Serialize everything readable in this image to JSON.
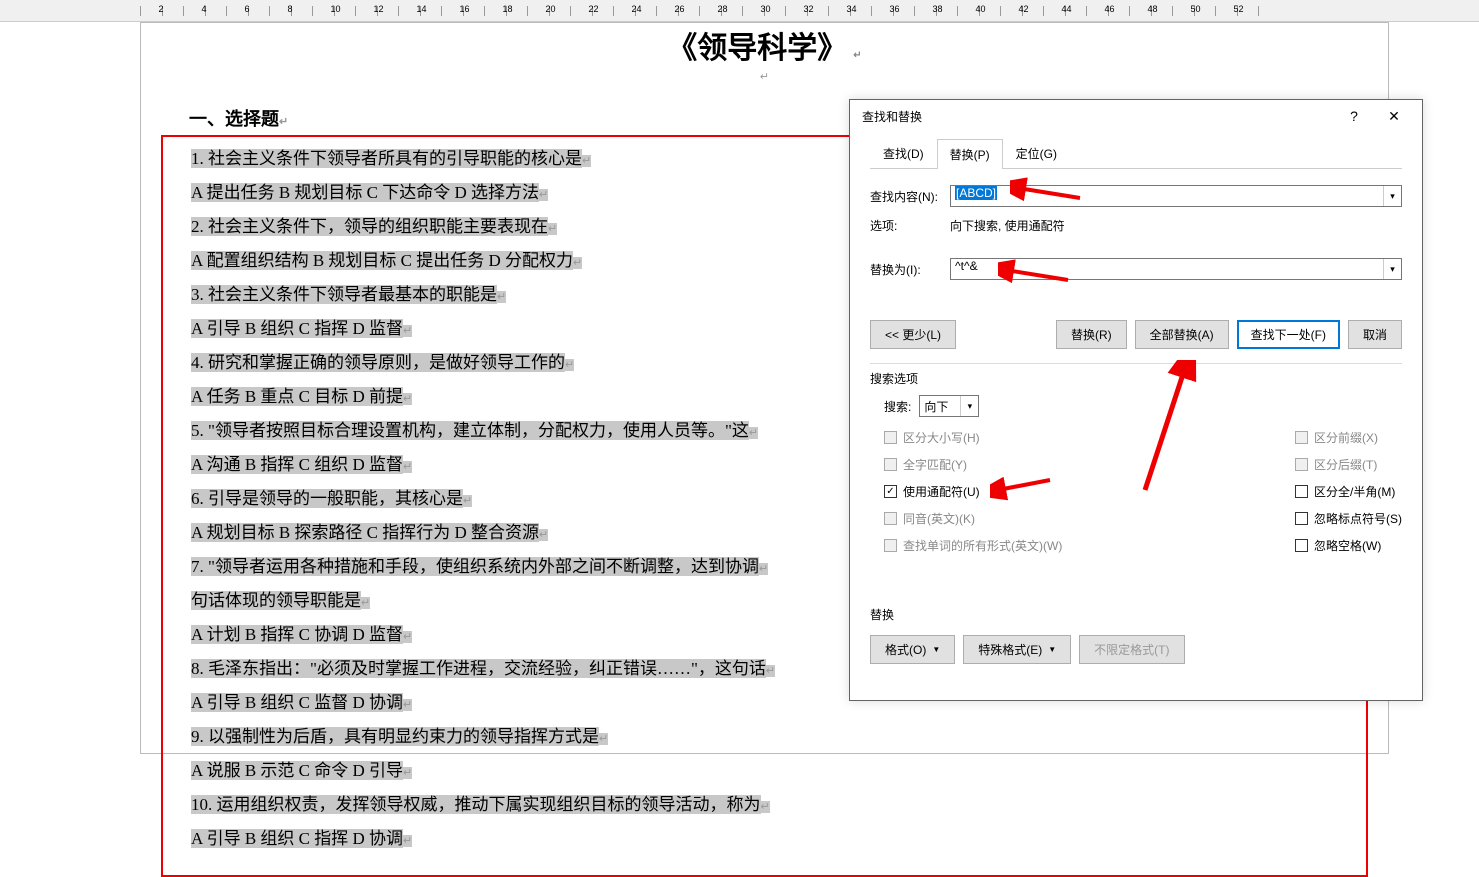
{
  "ruler": {
    "marks": [
      "",
      "2",
      "",
      "4",
      "",
      "6",
      "",
      "8",
      "",
      "10",
      "",
      "12",
      "",
      "14",
      "",
      "16",
      "",
      "18",
      "",
      "20",
      "",
      "22",
      "",
      "24",
      "",
      "26",
      "",
      "28",
      "",
      "30",
      "",
      "32",
      "",
      "34",
      "",
      "36",
      "",
      "38",
      "",
      "40",
      "",
      "42",
      "",
      "44",
      "",
      "46",
      "",
      "48",
      "",
      "50",
      "",
      "52",
      ""
    ]
  },
  "doc": {
    "title": "《领导科学》",
    "section": "一、选择题",
    "lines": [
      "1. 社会主义条件下领导者所具有的引导职能的核心是",
      "A 提出任务 B 规划目标 C 下达命令 D 选择方法",
      "2. 社会主义条件下，领导的组织职能主要表现在",
      "A 配置组织结构 B 规划目标 C 提出任务 D 分配权力",
      "3. 社会主义条件下领导者最基本的职能是",
      "A 引导 B 组织 C 指挥 D 监督",
      "4. 研究和掌握正确的领导原则，是做好领导工作的",
      "A 任务 B 重点 C 目标 D 前提",
      "5. \"领导者按照目标合理设置机构，建立体制，分配权力，使用人员等。\"这",
      "A 沟通 B 指挥 C 组织 D 监督",
      "6. 引导是领导的一般职能，其核心是",
      "A 规划目标 B 探索路径 C 指挥行为 D 整合资源",
      "7. \"领导者运用各种措施和手段，使组织系统内外部之间不断调整，达到协调",
      "句话体现的领导职能是",
      "A 计划 B 指挥 C 协调 D 监督",
      "8. 毛泽东指出：\"必须及时掌握工作进程，交流经验，纠正错误……\"，这句话",
      "A 引导 B 组织 C 监督 D 协调",
      "9. 以强制性为后盾，具有明显约束力的领导指挥方式是",
      "A 说服 B 示范 C 命令 D 引导",
      "10. 运用组织权责，发挥领导权威，推动下属实现组织目标的领导活动，称为",
      "A 引导 B 组织 C 指挥 D 协调"
    ]
  },
  "dialog": {
    "title": "查找和替换",
    "tabs": {
      "find": "查找(D)",
      "replace": "替换(P)",
      "goto": "定位(G)"
    },
    "findLabel": "查找内容(N):",
    "findValue": "[ABCD]",
    "optionsLabel": "选项:",
    "optionsValue": "向下搜索, 使用通配符",
    "replaceLabel": "替换为(I):",
    "replaceValue": "^t^&",
    "buttons": {
      "less": "<< 更少(L)",
      "replace": "替换(R)",
      "replaceAll": "全部替换(A)",
      "findNext": "查找下一处(F)",
      "cancel": "取消"
    },
    "searchOptions": "搜索选项",
    "searchLabel": "搜索:",
    "searchDir": "向下",
    "checks": {
      "matchCase": "区分大小写(H)",
      "wholeWord": "全字匹配(Y)",
      "wildcards": "使用通配符(U)",
      "soundsLike": "同音(英文)(K)",
      "wordForms": "查找单词的所有形式(英文)(W)",
      "prefix": "区分前缀(X)",
      "suffix": "区分后缀(T)",
      "fullHalf": "区分全/半角(M)",
      "ignorePunct": "忽略标点符号(S)",
      "ignoreSpace": "忽略空格(W)"
    },
    "replaceSection": "替换",
    "formatBtn": "格式(O)",
    "specialBtn": "特殊格式(E)",
    "noFormatBtn": "不限定格式(T)"
  }
}
